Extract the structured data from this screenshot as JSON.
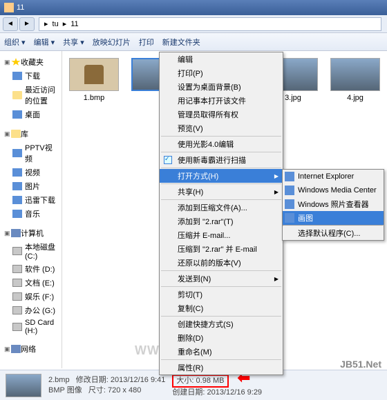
{
  "window": {
    "title": "11"
  },
  "breadcrumb": {
    "parts": [
      "▸",
      "tu",
      "▸",
      "11"
    ]
  },
  "toolbar": {
    "organize": "组织 ▾",
    "edit": "编辑 ▾",
    "share": "共享 ▾",
    "slideshow": "放映幻灯片",
    "print": "打印",
    "newfolder": "新建文件夹"
  },
  "sidebar": {
    "favorites": {
      "label": "收藏夹",
      "items": [
        "下载",
        "最近访问的位置",
        "桌面"
      ]
    },
    "libraries": {
      "label": "库",
      "items": [
        "PPTV视频",
        "视频",
        "图片",
        "迅雷下载",
        "音乐"
      ]
    },
    "computer": {
      "label": "计算机",
      "items": [
        "本地磁盘 (C:)",
        "软件 (D:)",
        "文档 (E:)",
        "娱乐 (F:)",
        "办公 (G:)",
        "SD Card (H:)"
      ]
    },
    "network": {
      "label": "网络"
    }
  },
  "thumbs": {
    "t1": "1.bmp",
    "t3": "3.jpg",
    "t4": "4.jpg"
  },
  "ctx": {
    "edit": "编辑",
    "print": "打印(P)",
    "setbg": "设置为桌面背景(B)",
    "notepad": "用记事本打开该文件",
    "admin": "管理员取得所有权",
    "preview": "预览(V)",
    "shadow": "使用光影4.0编辑",
    "scan": "使用新毒霸进行扫描",
    "openwith": "打开方式(H)",
    "share": "共享(H)",
    "compress_a": "添加到压缩文件(A)...",
    "compress_t": "添加到 \"2.rar\"(T)",
    "email": "压缩并 E-mail...",
    "email2": "压缩到 \"2.rar\" 并 E-mail",
    "restore": "还原以前的版本(V)",
    "sendto": "发送到(N)",
    "cut": "剪切(T)",
    "copy": "复制(C)",
    "shortcut": "创建快捷方式(S)",
    "delete": "删除(D)",
    "rename": "重命名(M)",
    "props": "属性(R)"
  },
  "submenu": {
    "ie": "Internet Explorer",
    "wmc": "Windows Media Center",
    "viewer": "Windows 照片查看器",
    "paint": "画图",
    "choose": "选择默认程序(C)..."
  },
  "watermark": "WWW.PC841.COM",
  "status": {
    "filename": "2.bmp",
    "moddate_label": "修改日期:",
    "moddate": "2013/12/16 9:41",
    "filetype": "BMP 图像",
    "dim_label": "尺寸:",
    "dim": "720 x 480",
    "size_label": "大小:",
    "size": "0.98 MB",
    "created_label": "创建日期:",
    "created": "2013/12/16 9:29"
  },
  "footer_right": "JB51.Net"
}
